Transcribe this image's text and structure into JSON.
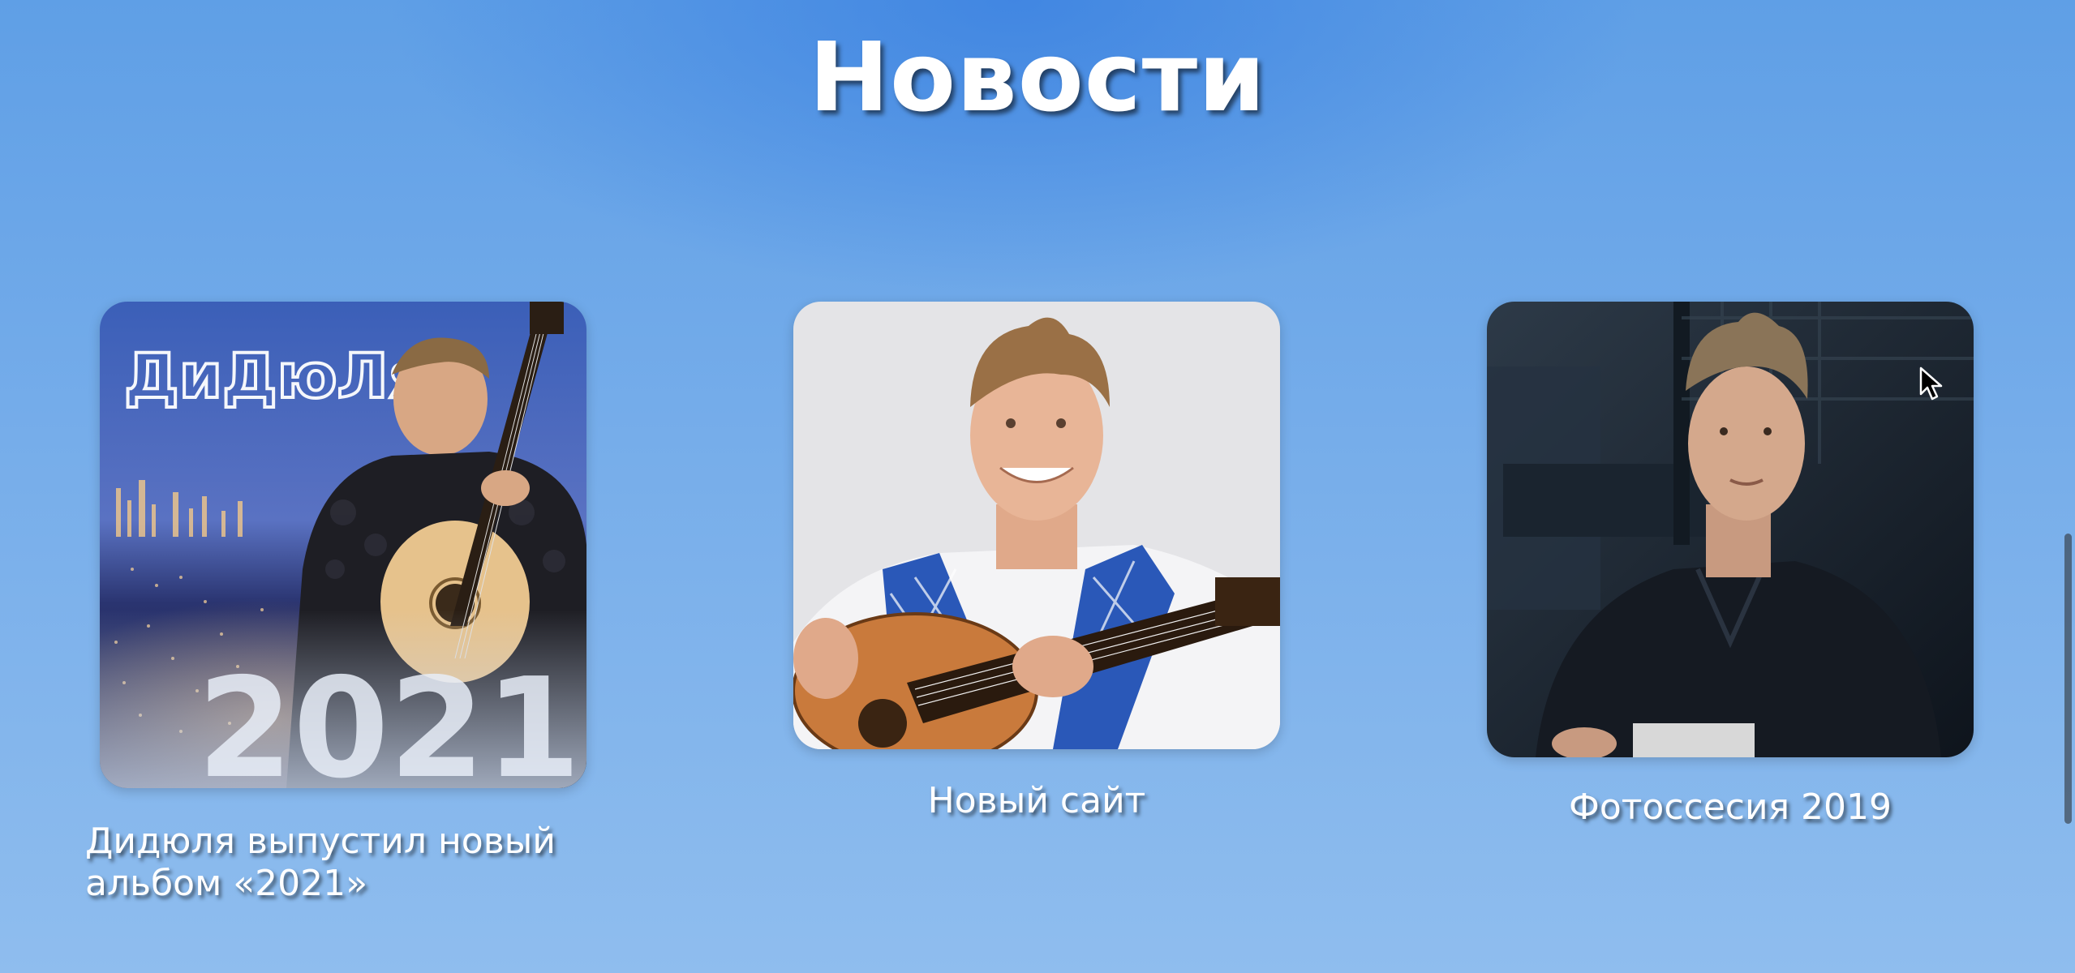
{
  "page": {
    "title": "Новости"
  },
  "news": [
    {
      "caption": "Дидюля выпустил новый альбом «2021»",
      "image_overlay": {
        "logo_text": "ДиДюЛя",
        "year_text": "2021"
      }
    },
    {
      "caption": "Новый сайт"
    },
    {
      "caption": "Фотоссесия 2019"
    }
  ],
  "colors": {
    "background_top": "#5f9fe6",
    "background_bottom": "#8fbdee",
    "text": "#ffffff"
  },
  "icons": {
    "cursor": "mouse-pointer-icon"
  }
}
